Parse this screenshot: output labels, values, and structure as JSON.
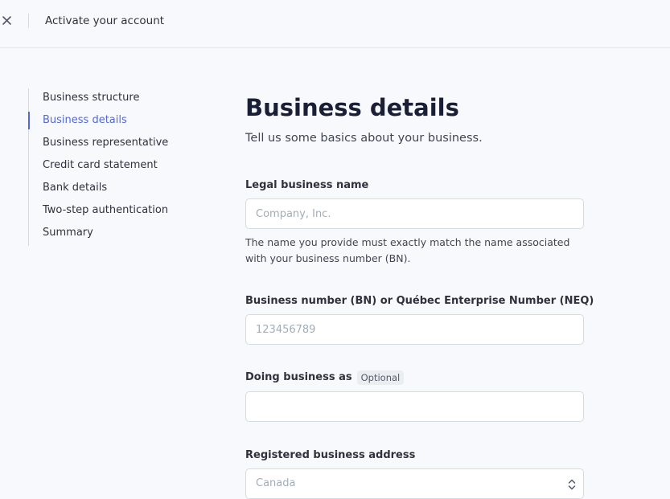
{
  "header": {
    "close_icon": "close-icon",
    "title": "Activate your account"
  },
  "sidebar": {
    "items": [
      {
        "label": "Business structure",
        "active": false
      },
      {
        "label": "Business details",
        "active": true
      },
      {
        "label": "Business representative",
        "active": false
      },
      {
        "label": "Credit card statement",
        "active": false
      },
      {
        "label": "Bank details",
        "active": false
      },
      {
        "label": "Two-step authentication",
        "active": false
      },
      {
        "label": "Summary",
        "active": false
      }
    ]
  },
  "main": {
    "title": "Business details",
    "subtitle": "Tell us some basics about your business.",
    "legal_name": {
      "label": "Legal business name",
      "placeholder": "Company, Inc.",
      "value": "",
      "help": "The name you provide must exactly match the name associated with your business number (BN)."
    },
    "business_number": {
      "label": "Business number (BN) or Québec Enterprise Number (NEQ)",
      "placeholder": "123456789",
      "value": ""
    },
    "dba": {
      "label": "Doing business as",
      "badge": "Optional",
      "value": ""
    },
    "address": {
      "label": "Registered business address",
      "country_value": "Canada",
      "chevron_icon": "chevron-up-down-icon"
    }
  },
  "colors": {
    "accent": "#5469d4",
    "background": "#f7f9fc",
    "border": "#d5dbe1",
    "text": "#30313d",
    "placeholder": "#a3acb9"
  }
}
